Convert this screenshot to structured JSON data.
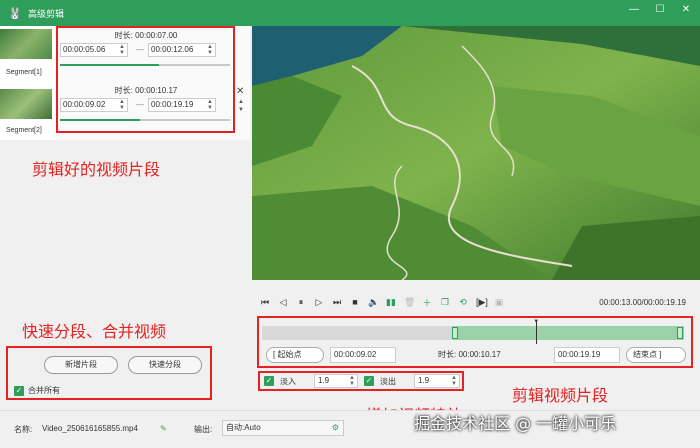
{
  "window": {
    "title": "高级剪辑",
    "minimize": "—",
    "maximize": "☐",
    "close": "✕"
  },
  "segments": [
    {
      "thumb_label": "Segment[1]",
      "duration": "时长: 00:00:07.00",
      "start": "00:00:05.06",
      "end": "00:00:12.06",
      "progress": 0.58
    },
    {
      "thumb_label": "Segment[2]",
      "duration": "时长: 00:00:10.17",
      "start": "00:00:09.02",
      "end": "00:00:19.19",
      "progress": 0.47
    }
  ],
  "segment_separator": "—",
  "segment_close": "✕",
  "buttons": {
    "add_segment": "新增片段",
    "quick_split": "快速分段",
    "merge_all": "合并所有"
  },
  "annotations": {
    "clipped_segments": "剪辑好的视频片段",
    "split_merge": "快速分段、合并视频",
    "clip_video": "剪辑视频片段",
    "add_effects": "增加视频特效"
  },
  "player": {
    "time": "00:00:13.00/00:00:19.19"
  },
  "timeline": {
    "selection_start": 0.45,
    "selection_end": 1.0,
    "playhead": 0.65
  },
  "range": {
    "start_btn": "[ 起始点",
    "start_value": "00:00:09.02",
    "duration": "时长: 00:00:10.17",
    "end_value": "00:00:19.19",
    "end_btn": "结束点 ]"
  },
  "effects": {
    "fade_in_label": "淡入",
    "fade_in_value": "1.9",
    "fade_out_label": "淡出",
    "fade_out_value": "1.9"
  },
  "footer": {
    "name_label": "名称:",
    "name_value": "Video_250616165855.mp4",
    "output_label": "输出:",
    "output_value": "自动:Auto"
  },
  "watermark": "掘金技术社区 @ 一罐小可乐"
}
